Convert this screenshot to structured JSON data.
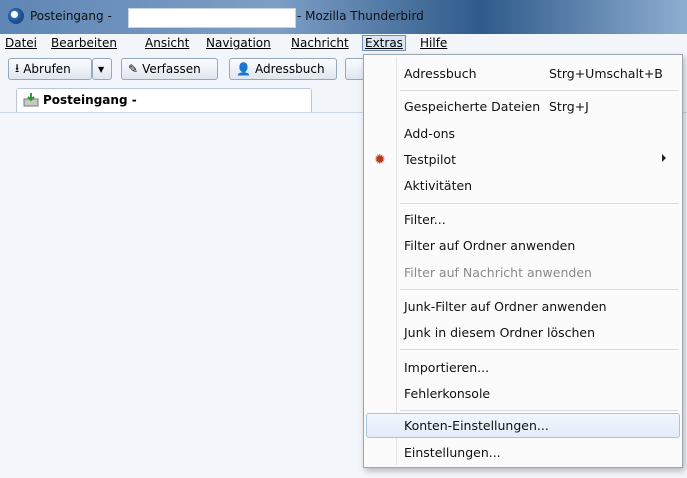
{
  "window": {
    "title_left": "Posteingang -",
    "title_right": "- Mozilla Thunderbird"
  },
  "menubar": [
    "Datei",
    "Bearbeiten",
    "Ansicht",
    "Navigation",
    "Nachricht",
    "Extras",
    "Hilfe"
  ],
  "toolbar": {
    "abrufen": "Abrufen",
    "verfassen": "Verfassen",
    "adressbuch": "Adressbuch"
  },
  "tab": {
    "label": "Posteingang -"
  },
  "extras_menu": {
    "items": [
      {
        "label": "Adressbuch",
        "shortcut": "Strg+Umschalt+B"
      },
      {
        "label": "Gespeicherte Dateien",
        "shortcut": "Strg+J"
      },
      {
        "label": "Add-ons",
        "shortcut": ""
      },
      {
        "label": "Testpilot",
        "shortcut": ""
      },
      {
        "label": "Aktivitäten",
        "shortcut": ""
      },
      {
        "label": "Filter...",
        "shortcut": ""
      },
      {
        "label": "Filter auf Ordner anwenden",
        "shortcut": ""
      },
      {
        "label": "Filter auf Nachricht anwenden",
        "shortcut": ""
      },
      {
        "label": "Junk-Filter auf Ordner anwenden",
        "shortcut": ""
      },
      {
        "label": "Junk in diesem Ordner löschen",
        "shortcut": ""
      },
      {
        "label": "Importieren...",
        "shortcut": ""
      },
      {
        "label": "Fehlerkonsole",
        "shortcut": ""
      },
      {
        "label": "Konten-Einstellungen...",
        "shortcut": ""
      },
      {
        "label": "Einstellungen...",
        "shortcut": ""
      }
    ]
  }
}
